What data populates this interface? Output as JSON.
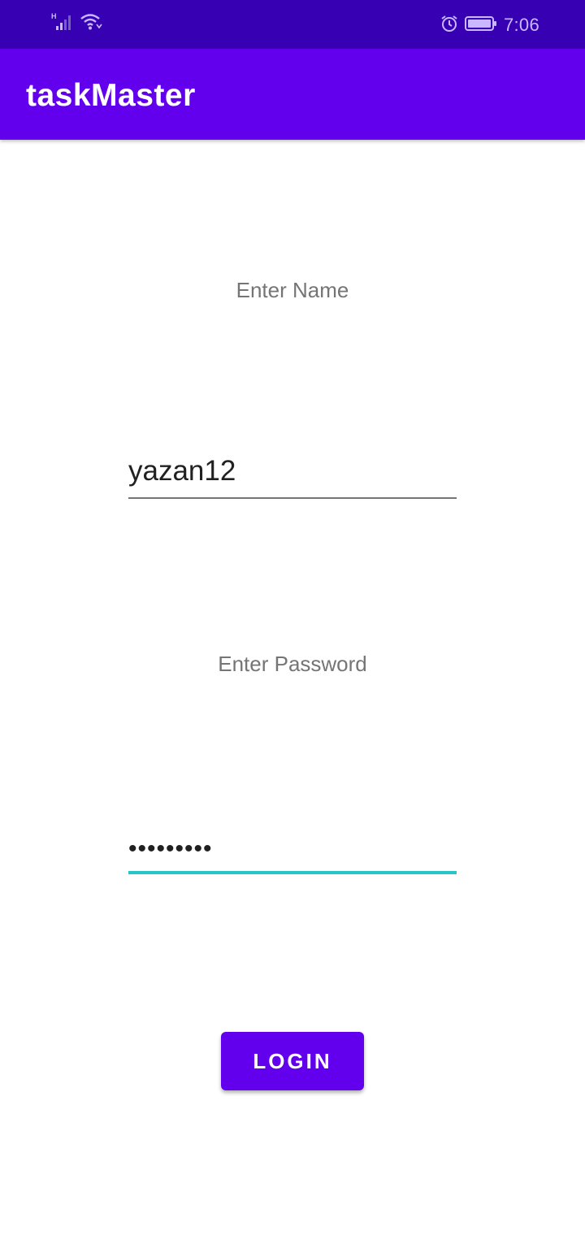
{
  "status_bar": {
    "time": "7:06",
    "network_label": "H",
    "icons": [
      "signal-icon",
      "wifi-icon",
      "alarm-icon",
      "battery-icon"
    ]
  },
  "app_bar": {
    "title": "taskMaster"
  },
  "form": {
    "name_label": "Enter Name",
    "name_value": "yazan12",
    "password_label": "Enter Password",
    "password_value": "•••••••••",
    "login_label": "LOGIN"
  },
  "colors": {
    "status_bar": "#3700b3",
    "app_bar": "#6200ee",
    "accent": "#26c6c6",
    "button": "#6200ee"
  }
}
